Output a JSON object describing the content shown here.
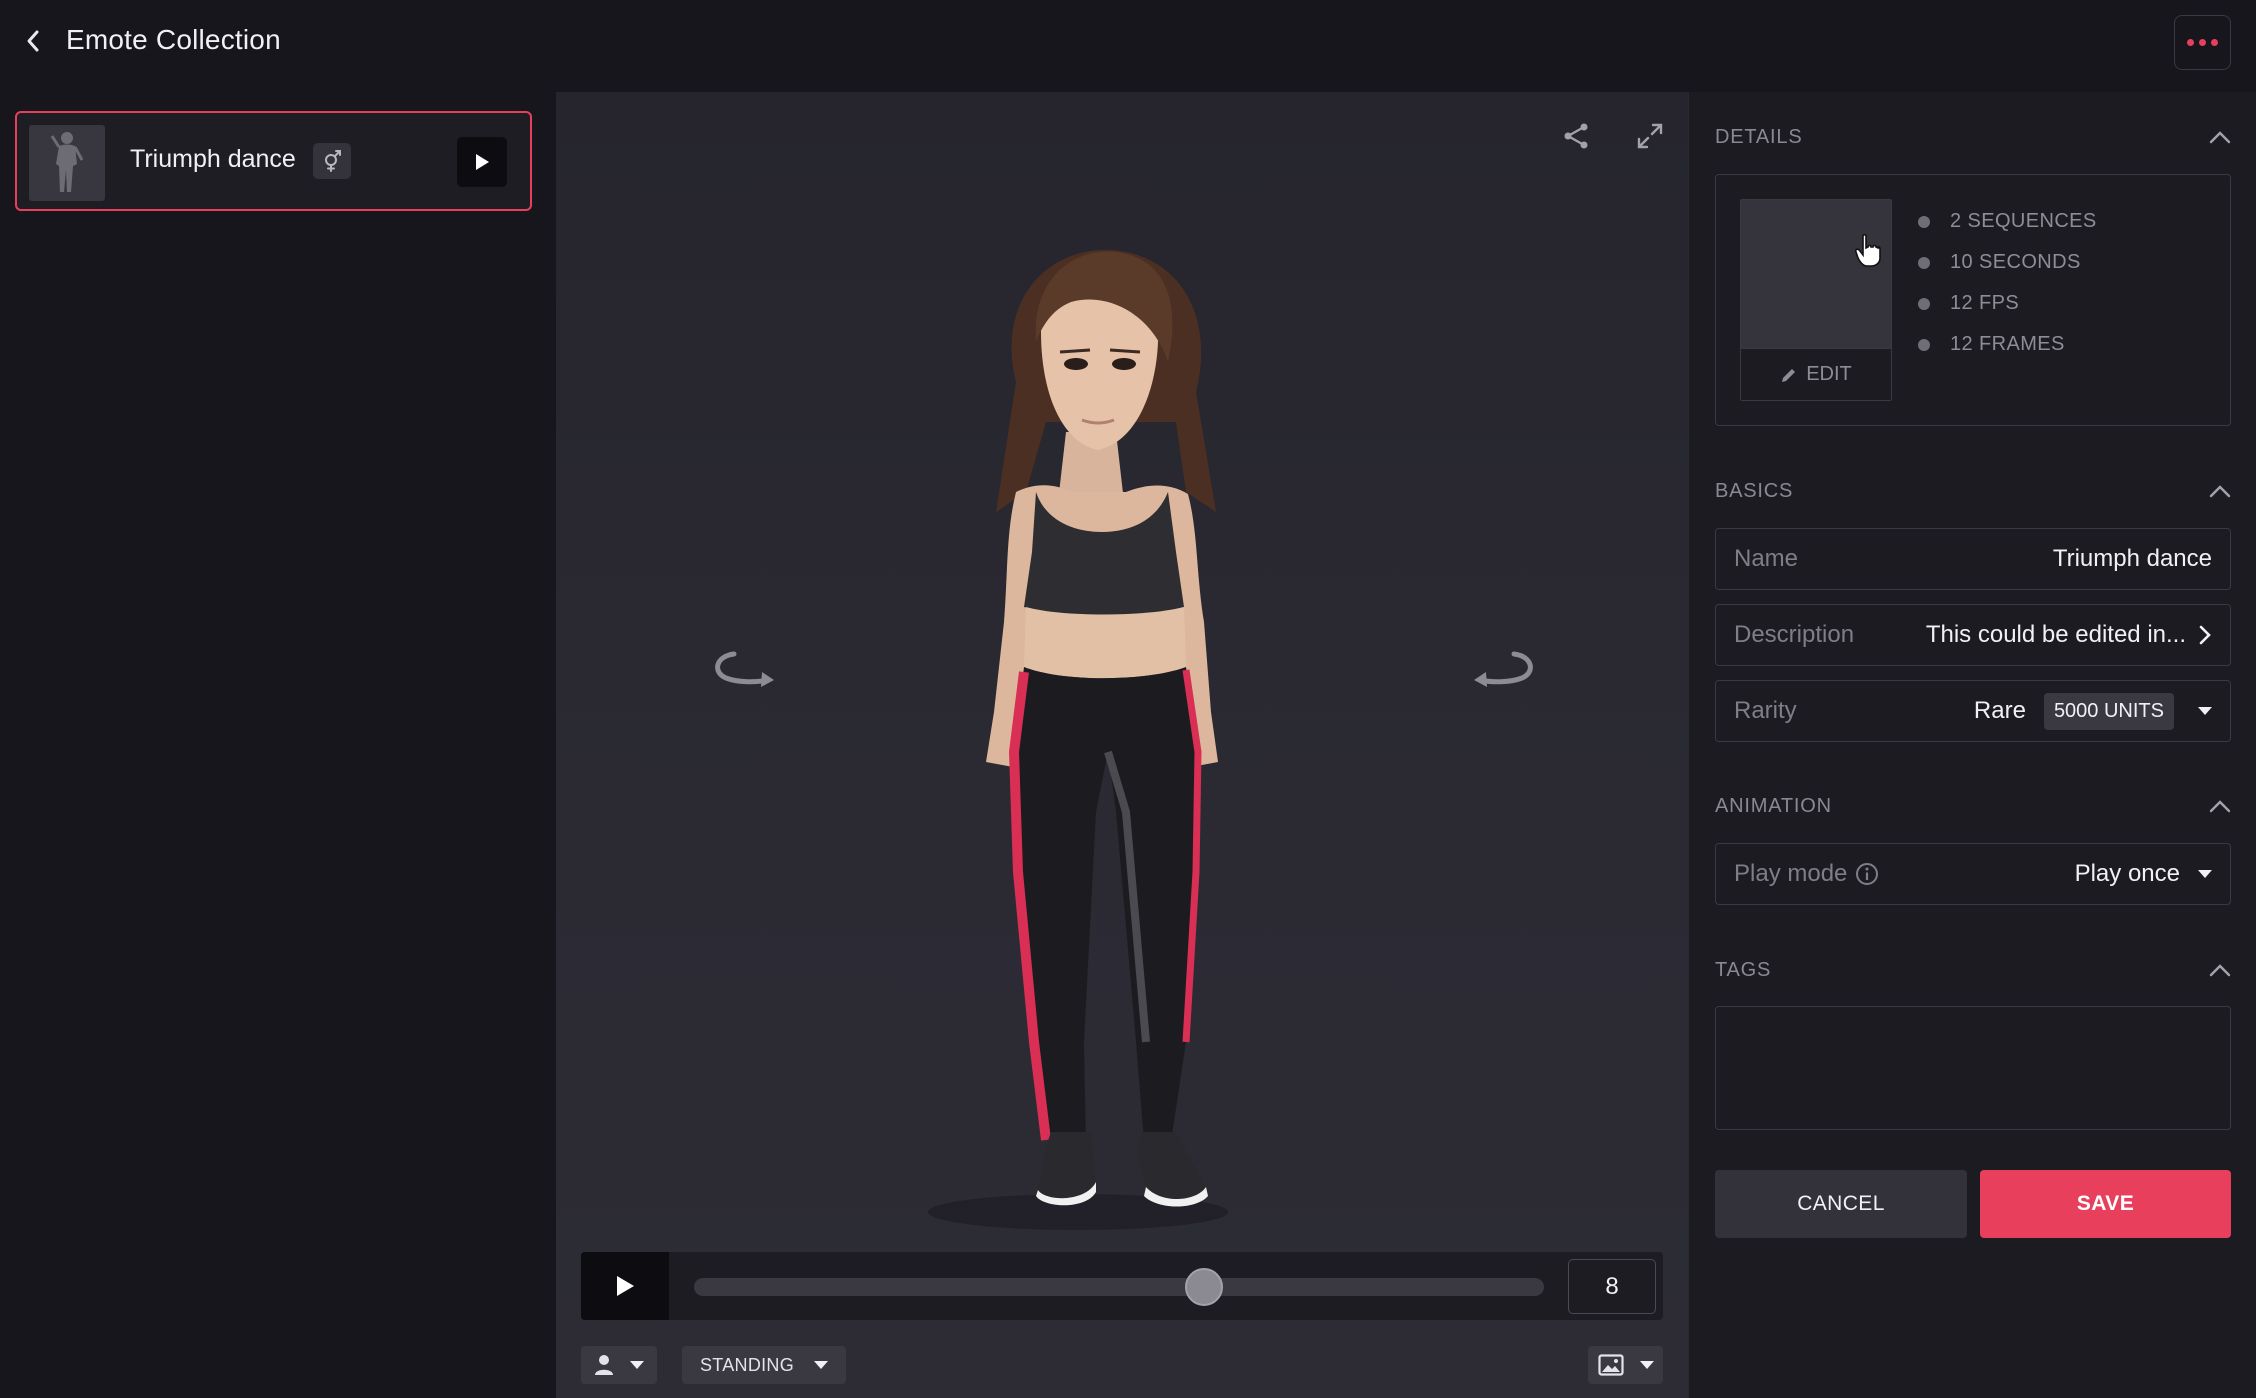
{
  "header": {
    "title": "Emote Collection"
  },
  "emotes": [
    {
      "name": "Triumph dance",
      "selected": true,
      "gender_icon": "unisex-icon"
    }
  ],
  "viewport": {
    "timeline": {
      "frame": "8",
      "progress": 0.6
    },
    "pose_label": "STANDING"
  },
  "details": {
    "title": "DETAILS",
    "edit_label": "EDIT",
    "stats": [
      "2 SEQUENCES",
      "10 SECONDS",
      "12 FPS",
      "12 FRAMES"
    ]
  },
  "basics": {
    "title": "BASICS",
    "name_label": "Name",
    "name_value": "Triumph dance",
    "description_label": "Description",
    "description_value": "This could be edited in...",
    "rarity_label": "Rarity",
    "rarity_value": "Rare",
    "rarity_units": "5000 UNITS"
  },
  "animation": {
    "title": "ANIMATION",
    "play_mode_label": "Play mode",
    "play_mode_value": "Play once"
  },
  "tags": {
    "title": "TAGS"
  },
  "actions": {
    "cancel": "CANCEL",
    "save": "SAVE"
  },
  "colors": {
    "accent": "#e8405c",
    "background": "#17161c",
    "panel": "#1c1b22"
  }
}
